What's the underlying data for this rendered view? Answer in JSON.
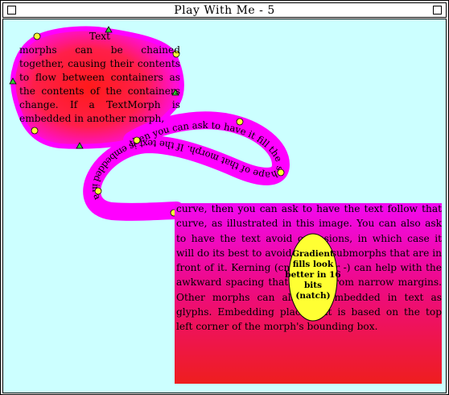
{
  "window": {
    "title": "Play With Me - 5"
  },
  "text_block_1": {
    "lines": [
      "Text",
      "morphs can be chained together, causing their contents to flow between containers as the contents of the containers change. If a TextMorph is embedded in another morph,"
    ]
  },
  "curve_text": "then you can ask to have it fill the shape of that morph. If the text is embedded in a",
  "text_block_2": {
    "paragraph": "curve, then you can ask to have the text follow that curve, as illustrated in this image. You can also ask to have the text avoid occlusions, in which case it will do its best to avoid sibling submorphs that are in front of it. Kerning (cmd-sh + or -) can help with the awkward spacing that results from narrow margins. Other morphs can also be embedded in text as glyphs. Embedding placement is based on the top left corner of the morph's bounding box."
  },
  "ellipse": {
    "label": "Gradient fills look better in 16 bits (natch)",
    "lines": [
      "Gradient",
      "fills look",
      "better in 16",
      "bits",
      "(natch)"
    ]
  },
  "colors": {
    "canvas": "#ccffff",
    "magenta": "#ff00ff",
    "blob_center": "#ff1a1a",
    "handle_yellow": "#ffff33",
    "handle_green": "#33cc33"
  }
}
